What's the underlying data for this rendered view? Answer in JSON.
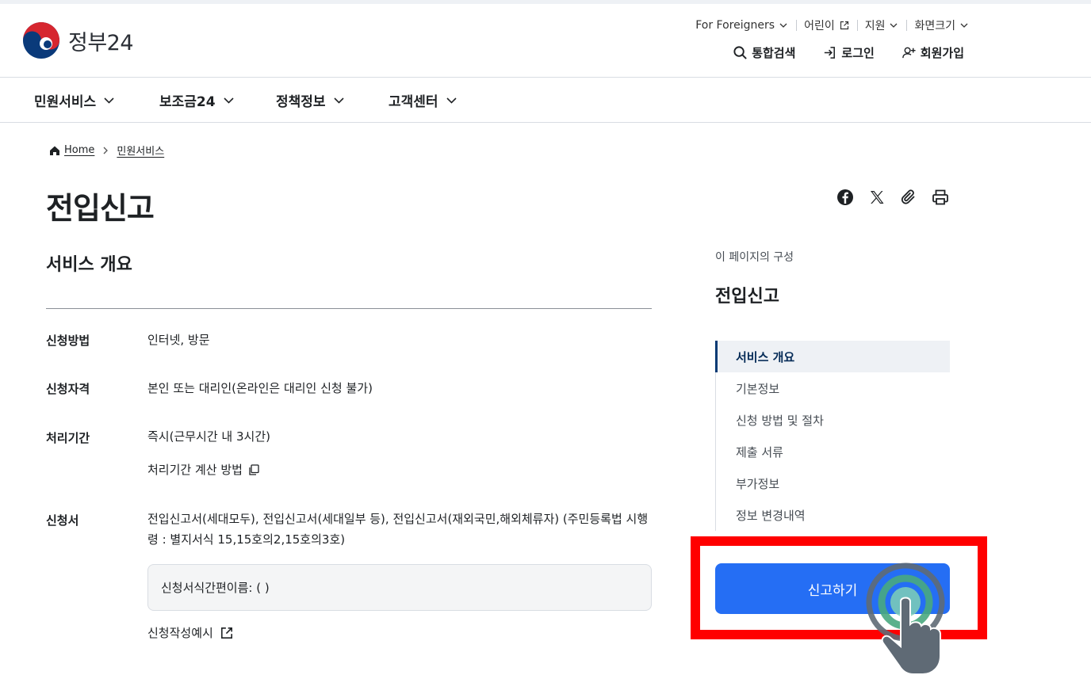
{
  "header": {
    "logo_text": "정부24",
    "util": [
      {
        "label": "For Foreigners",
        "icon": "chevron-down-icon"
      },
      {
        "label": "어린이",
        "icon": "external-link-icon"
      },
      {
        "label": "지원",
        "icon": "chevron-down-icon"
      },
      {
        "label": "화면크기",
        "icon": "chevron-down-icon"
      }
    ],
    "search_label": "통합검색",
    "login_label": "로그인",
    "signup_label": "회원가입"
  },
  "gnb": {
    "items": [
      "민원서비스",
      "보조금24",
      "정책정보",
      "고객센터"
    ]
  },
  "breadcrumb": {
    "home": "Home",
    "current": "민원서비스"
  },
  "page": {
    "title": "전입신고",
    "section_title": "서비스 개요",
    "rows": {
      "method_label": "신청방법",
      "method_value": "인터넷, 방문",
      "eligibility_label": "신청자격",
      "eligibility_value": "본인 또는 대리인(온라인은 대리인 신청 불가)",
      "period_label": "처리기간",
      "period_value": "즉시(근무시간 내 3시간)",
      "period_link": "처리기간 계산 방법",
      "form_label": "신청서",
      "form_value": "전입신고서(세대모두), 전입신고서(세대일부 등), 전입신고서(재외국민,해외체류자) (주민등록법 시행령 : 별지서식 15,15호의2,15호의3호)",
      "form_box": "신청서식간편이름: ( )",
      "form_example": "신청작성예시"
    }
  },
  "share_icons": [
    "facebook-icon",
    "x-icon",
    "clip-icon",
    "print-icon"
  ],
  "toc": {
    "caption": "이 페이지의 구성",
    "title": "전입신고",
    "items": [
      "서비스 개요",
      "기본정보",
      "신청 방법 및 절차",
      "제출 서류",
      "부가정보",
      "정보 변경내역"
    ]
  },
  "apply_button": "신고하기",
  "colors": {
    "primary_button": "#256ef4",
    "highlight": "#ff0000",
    "active_toc": "#063a74"
  }
}
